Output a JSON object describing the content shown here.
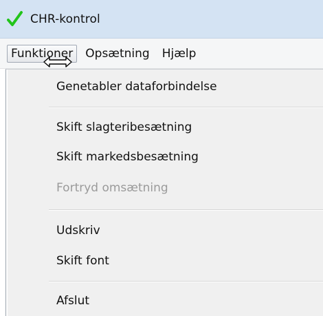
{
  "window": {
    "title": "CHR-kontrol",
    "icon": "green-checkmark-icon",
    "icon_color": "#22c41a"
  },
  "menubar": {
    "items": [
      {
        "label": "Funktioner",
        "active": true
      },
      {
        "label": "Opsætning",
        "active": false
      },
      {
        "label": "Hjælp",
        "active": false
      }
    ]
  },
  "dropdown": {
    "items": [
      {
        "label": "Genetabler dataforbindelse",
        "enabled": true
      },
      {
        "label": "Skift slagteribesætning",
        "enabled": true
      },
      {
        "label": "Skift markedsbesætning",
        "enabled": true
      },
      {
        "label": "Fortryd omsætning",
        "enabled": false
      },
      {
        "label": "Udskriv",
        "enabled": true
      },
      {
        "label": "Skift font",
        "enabled": true
      },
      {
        "label": "Afslut",
        "enabled": true
      }
    ]
  },
  "cursor": {
    "icon": "horizontal-resize-cursor-icon"
  }
}
